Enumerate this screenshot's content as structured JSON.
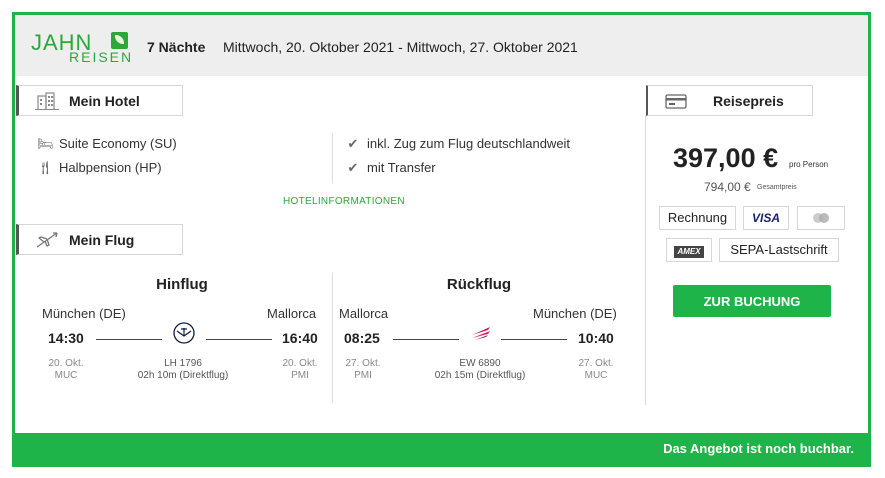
{
  "header": {
    "logo_top": "JAHN",
    "logo_bottom": "REISEN",
    "nights": "7 Nächte",
    "dates": "Mittwoch, 20. Oktober 2021 - Mittwoch, 27. Oktober 2021"
  },
  "hotel": {
    "tab_label": "Mein Hotel",
    "room": "Suite Economy (SU)",
    "board": "Halbpension (HP)",
    "features": [
      "inkl. Zug zum Flug deutschlandweit",
      "mit Transfer"
    ],
    "info_link": "HOTELINFORMATIONEN"
  },
  "flight": {
    "tab_label": "Mein Flug",
    "outbound": {
      "title": "Hinflug",
      "from_city": "München (DE)",
      "to_city": "Mallorca",
      "dep_time": "14:30",
      "arr_time": "16:40",
      "dep_date": "20. Okt.",
      "dep_code": "MUC",
      "arr_date": "20. Okt.",
      "arr_code": "PMI",
      "flight_no": "LH 1796",
      "duration": "02h 10m (Direktflug)",
      "airline_icon": "lufthansa-logo"
    },
    "return": {
      "title": "Rückflug",
      "from_city": "Mallorca",
      "to_city": "München (DE)",
      "dep_time": "08:25",
      "arr_time": "10:40",
      "dep_date": "27. Okt.",
      "dep_code": "PMI",
      "arr_date": "27. Okt.",
      "arr_code": "MUC",
      "flight_no": "EW 6890",
      "duration": "02h 15m (Direktflug)",
      "airline_icon": "eurowings-logo"
    }
  },
  "price": {
    "tab_label": "Reisepreis",
    "per_person": "397,00 €",
    "per_person_label": "pro Person",
    "total": "794,00 €",
    "total_label": "Gesamtpreis",
    "payment_methods": [
      "Rechnung",
      "VISA",
      "mastercard",
      "AMEX",
      "SEPA-Lastschrift"
    ],
    "book_label": "ZUR BUCHUNG"
  },
  "footer": {
    "status": "Das Angebot ist noch buchbar."
  },
  "colors": {
    "accent": "#1fb44a",
    "logo_green": "#2ca839",
    "header_bg": "#eeeeee"
  }
}
